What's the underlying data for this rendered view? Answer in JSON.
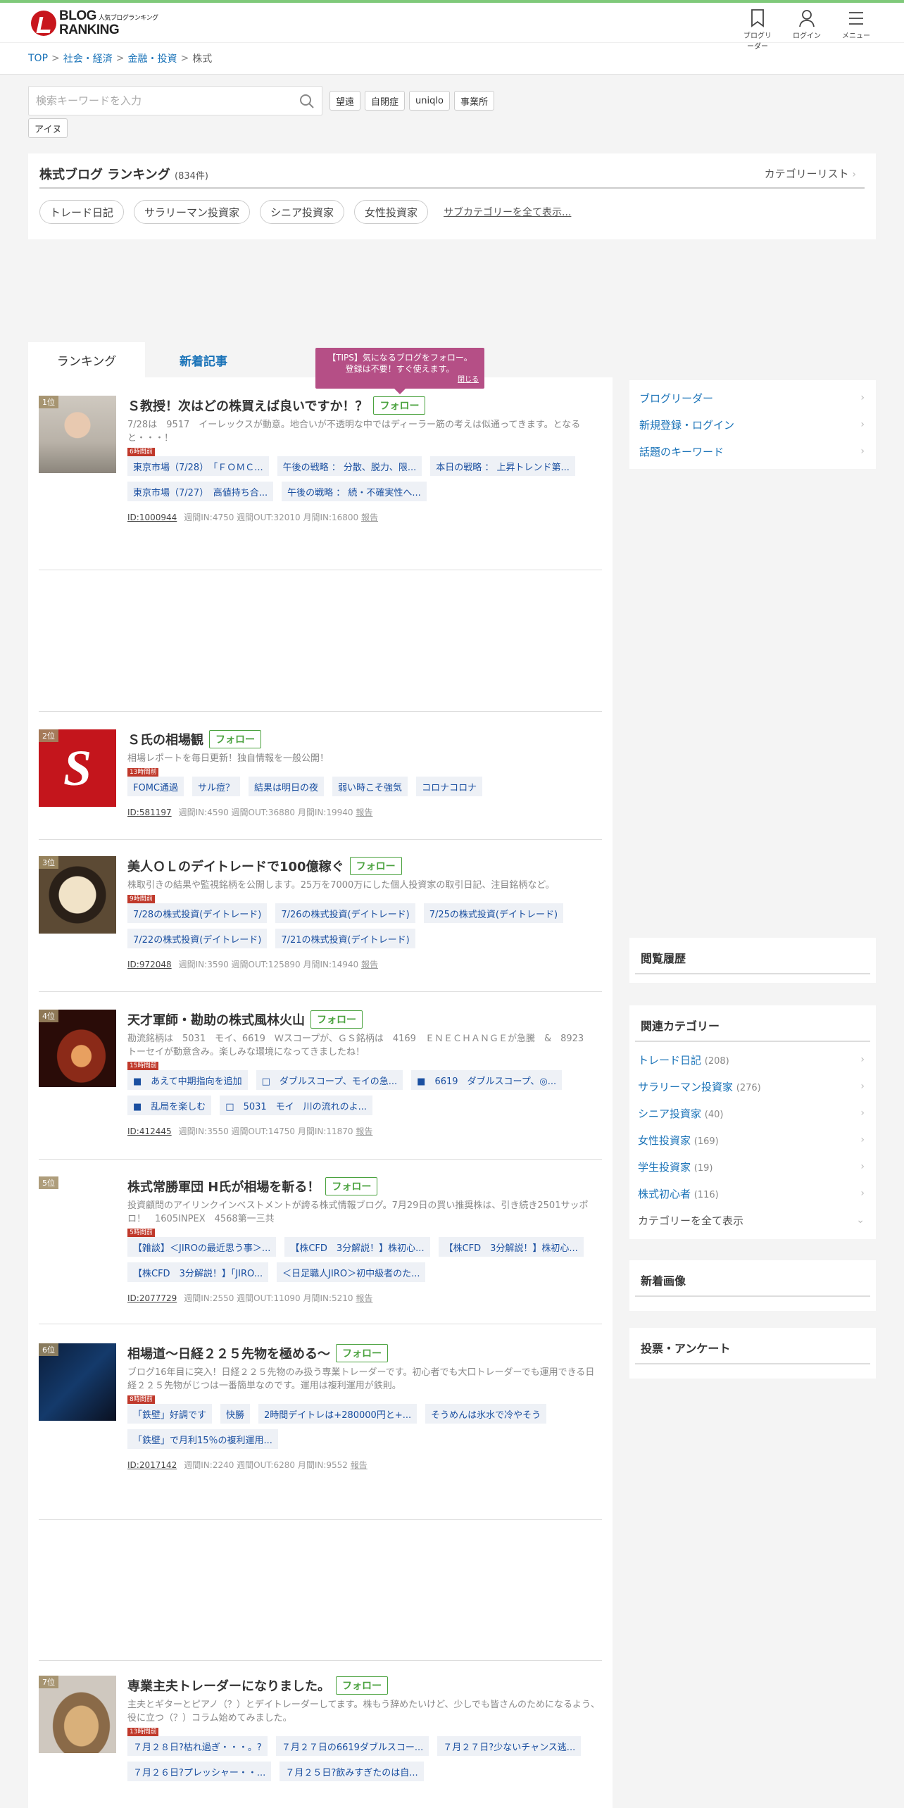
{
  "header": {
    "logo_line1": "BLOG",
    "logo_line2": "RANKING",
    "logo_sub": "人気ブログランキング",
    "nav": [
      {
        "label": "ブログリーダー",
        "icon": "bookmark-icon"
      },
      {
        "label": "ログイン",
        "icon": "user-icon"
      },
      {
        "label": "メニュー",
        "icon": "hamburger-icon"
      }
    ]
  },
  "breadcrumb": {
    "items": [
      "TOP",
      "社会・経済",
      "金融・投資"
    ],
    "current": "株式",
    "sep": ">"
  },
  "search": {
    "placeholder": "検索キーワードを入力",
    "keywords": [
      "望遠",
      "自閉症",
      "uniqlo",
      "事業所",
      "アイヌ"
    ]
  },
  "category": {
    "title": "株式ブログ ランキング",
    "count": "(834件)",
    "list_link": "カテゴリーリスト",
    "subcategories": [
      "トレード日記",
      "サラリーマン投資家",
      "シニア投資家",
      "女性投資家"
    ],
    "more_link": "サブカテゴリーを全て表示..."
  },
  "tabs": [
    "ランキング",
    "新着記事"
  ],
  "tips": {
    "text1": "【TIPS】気になるブログをフォロー。",
    "text2": "登録は不要！すぐ使えます。",
    "close": "閉じる"
  },
  "follow_label": "フォロー",
  "entries": [
    {
      "rank": "1位",
      "title": "Ｓ教授！次はどの株買えば良いですか！？",
      "desc": "7/28は　9517　イーレックスが動意。地合いが不透明な中ではディーラー筋の考えは似通ってきます。となると・・・！",
      "time": "6時間前",
      "articles": [
        "東京市場（7/28）　「ＦＯＭＣ...",
        "午後の戦略 ： 分散、脱力、限...",
        "本日の戦略 ： 上昇トレンド第...",
        "東京市場（7/27）　高値持ち合...",
        "午後の戦略 ： 続・不確実性へ..."
      ],
      "id": "ID:1000944",
      "stats": "週間IN:4750 週間OUT:32010 月間IN:16800",
      "report": "報告"
    },
    {
      "rank": "2位",
      "title": "Ｓ氏の相場観",
      "desc": "相場レポートを毎日更新！独自情報を一般公開！",
      "time": "13時間前",
      "articles": [
        "FOMC通過",
        "サル痘？",
        "結果は明日の夜",
        "弱い時こそ強気",
        "コロナコロナ"
      ],
      "id": "ID:581197",
      "stats": "週間IN:4590 週間OUT:36880 月間IN:19940",
      "report": "報告"
    },
    {
      "rank": "3位",
      "title": "美人ＯＬのデイトレードで100億稼ぐ",
      "desc": "株取引きの結果や監視銘柄を公開します。25万を7000万にした個人投資家の取引日記、注目銘柄など。",
      "time": "9時間前",
      "articles": [
        "7/28の株式投資(デイトレード)",
        "7/26の株式投資(デイトレード)",
        "7/25の株式投資(デイトレード)",
        "7/22の株式投資(デイトレード)",
        "7/21の株式投資(デイトレード)"
      ],
      "id": "ID:972048",
      "stats": "週間IN:3590 週間OUT:125890 月間IN:14940",
      "report": "報告"
    },
    {
      "rank": "4位",
      "title": "天才軍師・勘助の株式風林火山",
      "desc": "勘流銘柄は　5031　モイ、6619　Ｗスコープが、ＧＳ銘柄は　4169　ＥＮＥＣＨＡＮＧＥが急騰　&　8923　トーセイが動意含み。楽しみな環境になってきましたね！",
      "time": "15時間前",
      "articles": [
        "■　あえて中期指向を追加",
        "□　ダブルスコープ、モイの急...",
        "■　6619　ダブルスコープ、◎...",
        "■　乱局を楽しむ",
        "□　5031　モイ　川の流れのよ..."
      ],
      "id": "ID:412445",
      "stats": "週間IN:3550 週間OUT:14750 月間IN:11870",
      "report": "報告"
    },
    {
      "rank": "5位",
      "title": "株式常勝軍団 H氏が相場を斬る！",
      "desc": "投資顧問のアイリンクインベストメントが誇る株式情報ブログ。7月29日の買い推奨株は、引き続き2501サッポロ！　1605INPEX　4568第一三共",
      "time": "5時間前",
      "articles": [
        "【雑談】＜JIROの最近思う事＞...",
        "【株CFD　3分解説！】株初心...",
        "【株CFD　3分解説！】株初心...",
        "【株CFD　3分解説！】「JIRO...",
        "＜日足職人JIRO＞初中級者のた..."
      ],
      "id": "ID:2077729",
      "stats": "週間IN:2550 週間OUT:11090 月間IN:5210",
      "report": "報告"
    },
    {
      "rank": "6位",
      "title": "相場道〜日経２２５先物を極める〜",
      "desc": "ブログ16年目に突入！日経２２５先物のみ扱う専業トレーダーです。初心者でも大口トレーダーでも運用できる日経２２５先物がじつは一番簡単なのです。運用は複利運用が鉄則。",
      "time": "8時間前",
      "articles": [
        "「鉄壁」好調です",
        "快勝",
        "2時間デイトレは+280000円と+...",
        "そうめんは氷水で冷やそう",
        "「鉄壁」で月利15％の複利運用..."
      ],
      "id": "ID:2017142",
      "stats": "週間IN:2240 週間OUT:6280 月間IN:9552",
      "report": "報告"
    },
    {
      "rank": "7位",
      "title": "専業主夫トレーダーになりました。",
      "desc": "主夫とギターとピアノ（？）とデイトレーダーしてます。株もう辞めたいけど、少しでも皆さんのためになるよう、役に立つ（？）コラム始めてみました。",
      "time": "13時間前",
      "articles": [
        "７月２８日?枯れ過ぎ・・・。?",
        "７月２７日の6619ダブルスコー...",
        "７月２７日?少ないチャンス逃...",
        "７月２６日?プレッシャー・・...",
        "７月２５日?飲みすぎたのは自..."
      ],
      "id": "",
      "stats": "",
      "report": ""
    }
  ],
  "sidebar": {
    "links": [
      "ブログリーダー",
      "新規登録・ログイン",
      "話題のキーワード"
    ],
    "history_title": "閲覧履歴",
    "related_title": "関連カテゴリー",
    "related": [
      {
        "name": "トレード日記",
        "count": "(208)"
      },
      {
        "name": "サラリーマン投資家",
        "count": "(276)"
      },
      {
        "name": "シニア投資家",
        "count": "(40)"
      },
      {
        "name": "女性投資家",
        "count": "(169)"
      },
      {
        "name": "学生投資家",
        "count": "(19)"
      },
      {
        "name": "株式初心者",
        "count": "(116)"
      }
    ],
    "all_categories": "カテゴリーを全て表示",
    "new_images_title": "新着画像",
    "poll_title": "投票・アンケート"
  },
  "colors": {
    "accent": "#1a73b8",
    "follow": "#4aa23e",
    "tips": "#b54f86",
    "topline": "#7fc97a",
    "time_badge": "#c0392b"
  }
}
